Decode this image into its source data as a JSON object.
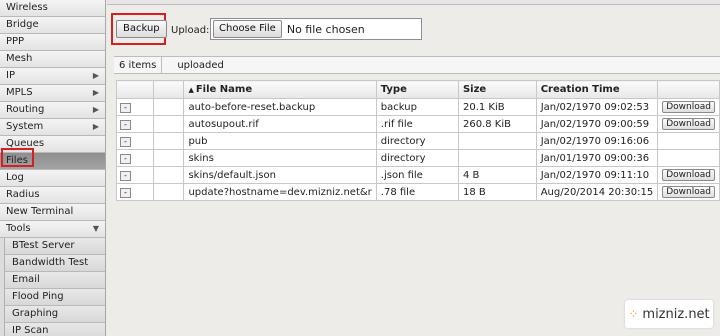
{
  "sidebar": {
    "items": [
      {
        "label": "Wireless",
        "arrow": false
      },
      {
        "label": "Bridge",
        "arrow": false
      },
      {
        "label": "PPP",
        "arrow": false
      },
      {
        "label": "Mesh",
        "arrow": false
      },
      {
        "label": "IP",
        "arrow": true
      },
      {
        "label": "MPLS",
        "arrow": true
      },
      {
        "label": "Routing",
        "arrow": true
      },
      {
        "label": "System",
        "arrow": true
      },
      {
        "label": "Queues",
        "arrow": false
      },
      {
        "label": "Files",
        "arrow": false,
        "active": true
      },
      {
        "label": "Log",
        "arrow": false
      },
      {
        "label": "Radius",
        "arrow": false
      },
      {
        "label": "New Terminal",
        "arrow": false
      },
      {
        "label": "Tools",
        "arrow": true,
        "expanded": true
      }
    ],
    "tools_sub": [
      "BTest Server",
      "Bandwidth Test",
      "Email",
      "Flood Ping",
      "Graphing",
      "IP Scan"
    ]
  },
  "toolbar": {
    "backup_label": "Backup",
    "upload_label": "Upload:",
    "choose_file_label": "Choose File",
    "file_status": "No file chosen"
  },
  "countbar": {
    "count": "6 items",
    "filter": "uploaded"
  },
  "table": {
    "columns": [
      "File Name",
      "Type",
      "Size",
      "Creation Time"
    ],
    "row_button": "-",
    "download_label": "Download",
    "rows": [
      {
        "name": "auto-before-reset.backup",
        "type": "backup",
        "size": "20.1 KiB",
        "time": "Jan/02/1970 09:02:53",
        "download": true
      },
      {
        "name": "autosupout.rif",
        "type": ".rif file",
        "size": "260.8 KiB",
        "time": "Jan/02/1970 09:00:59",
        "download": true
      },
      {
        "name": "pub",
        "type": "directory",
        "size": "",
        "time": "Jan/02/1970 09:16:06",
        "download": false
      },
      {
        "name": "skins",
        "type": "directory",
        "size": "",
        "time": "Jan/01/1970 09:00:36",
        "download": false
      },
      {
        "name": "skins/default.json",
        "type": ".json file",
        "size": "4 B",
        "time": "Jan/02/1970 09:11:10",
        "download": true
      },
      {
        "name": "update?hostname=dev.mizniz.net&r",
        "type": ".78 file",
        "size": "18 B",
        "time": "Aug/20/2014 20:30:15",
        "download": true
      }
    ]
  },
  "brand": {
    "text": "mizniz.net"
  },
  "colors": {
    "highlight": "#d42020",
    "active_item": "#999999"
  }
}
